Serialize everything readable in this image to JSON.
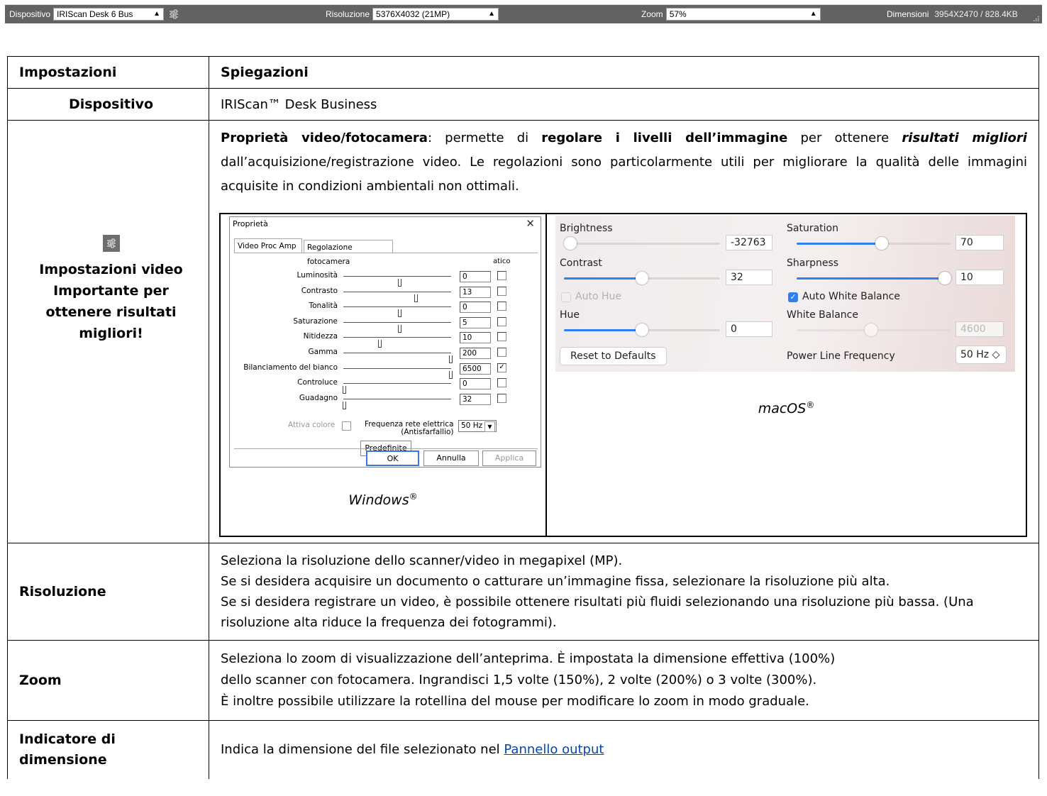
{
  "toolbar": {
    "device_label": "Dispositivo",
    "device_value": "IRIScan Desk 6 Bus",
    "resolution_label": "Risoluzione",
    "resolution_value": "5376X4032 (21MP)",
    "zoom_label": "Zoom",
    "zoom_value": "57%",
    "size_label": "Dimensioni",
    "size_value": "3954X2470 / 828.4KB",
    "arrow": "▲",
    "colors": {
      "bar": "#626262",
      "field": "#ffffff"
    }
  },
  "table": {
    "header": {
      "col1": "Impostazioni",
      "col2": "Spiegazioni"
    },
    "device": {
      "label": "Dispositivo",
      "text": "IRIScan™ Desk Business"
    },
    "video": {
      "icon": "settings-sliders-icon",
      "label_line1": "Impostazioni video",
      "label_line2": "Importante per",
      "label_line3": "ottenere risultati",
      "label_line4": "migliori!",
      "p_bold1": "Proprietà video/fotocamera",
      "p_text1": ": permette di ",
      "p_bold2": "regolare i livelli dell’immagine",
      "p_text2": " per ottenere ",
      "p_bolditalic": "risultati migliori",
      "p_text3": " dall’acquisizione/registrazione video. Le regolazioni sono particolarmente utili per migliorare la qualità delle immagini acquisite in condizioni ambientali non ottimali.",
      "windows_caption": "Windows",
      "mac_caption": "macOS",
      "reg": "®"
    },
    "resolution": {
      "label": "Risoluzione",
      "line1": "Seleziona la risoluzione dello scanner/video in megapixel (MP).",
      "line2": "Se si desidera acquisire un documento o catturare un’immagine fissa, selezionare la risoluzione più alta.",
      "line3": "Se si desidera registrare un video, è possibile ottenere risultati più fluidi selezionando una risoluzione più bassa. (Una risoluzione alta riduce la frequenza dei fotogrammi)."
    },
    "zoom": {
      "label": "Zoom",
      "line1": "Seleziona lo zoom di visualizzazione dell’anteprima. È impostata la dimensione effettiva (100%)",
      "line2": "dello scanner con fotocamera. Ingrandisci 1,5 volte (150%), 2 volte (200%) o 3 volte (300%).",
      "line3": "È inoltre possibile utilizzare la rotellina del mouse per modificare lo zoom in modo graduale."
    },
    "size": {
      "label_line1": "Indicatore di",
      "label_line2": "dimensione",
      "text": "Indica la dimensione del file selezionato nel ",
      "link": "Pannello output"
    }
  },
  "windows_dialog": {
    "title": "Proprietà",
    "close": "✕",
    "tabs": [
      "Video Proc Amp",
      "Regolazione fotocamera"
    ],
    "auto_header": "atico",
    "rows": [
      {
        "label": "Luminosità",
        "value": "0",
        "pos": 0.52,
        "auto": false
      },
      {
        "label": "Contrasto",
        "value": "13",
        "pos": 0.67,
        "auto": false
      },
      {
        "label": "Tonalità",
        "value": "0",
        "pos": 0.52,
        "auto": false
      },
      {
        "label": "Saturazione",
        "value": "5",
        "pos": 0.52,
        "auto": false
      },
      {
        "label": "Nitidezza",
        "value": "10",
        "pos": 0.33,
        "auto": false
      },
      {
        "label": "Gamma",
        "value": "200",
        "pos": 1.0,
        "auto": false
      },
      {
        "label": "Bilanciamento del bianco",
        "value": "6500",
        "pos": 1.0,
        "auto": true
      },
      {
        "label": "Controluce",
        "value": "0",
        "pos": 0.0,
        "auto": false
      },
      {
        "label": "Guadagno",
        "value": "32",
        "pos": 0.0,
        "auto": false
      }
    ],
    "color_enable": "Attiva colore",
    "powerline_label1": "Frequenza rete elettrica",
    "powerline_label2": "(Antisfarfallio)",
    "powerline_value": "50 Hz",
    "defaults_button": "Predefinite",
    "ok_button": "OK",
    "cancel_button": "Annulla",
    "apply_button": "Applica"
  },
  "mac_panel": {
    "brightness_label": "Brightness",
    "brightness_value": "-32763",
    "brightness_level": 0.0,
    "contrast_label": "Contrast",
    "contrast_value": "32",
    "contrast_level": 0.5,
    "auto_hue_label": "Auto Hue",
    "hue_label": "Hue",
    "hue_value": "0",
    "hue_level": 0.5,
    "reset_button": "Reset to Defaults",
    "saturation_label": "Saturation",
    "saturation_value": "70",
    "saturation_level": 0.55,
    "sharpness_label": "Sharpness",
    "sharpness_value": "10",
    "sharpness_level": 1.0,
    "auto_wb_label": "Auto White Balance",
    "wb_label": "White Balance",
    "wb_value": "4600",
    "wb_level": 0.48,
    "powerline_label": "Power Line Frequency",
    "powerline_value": "50 Hz ◇",
    "accent_color": "#2f7ff0"
  }
}
